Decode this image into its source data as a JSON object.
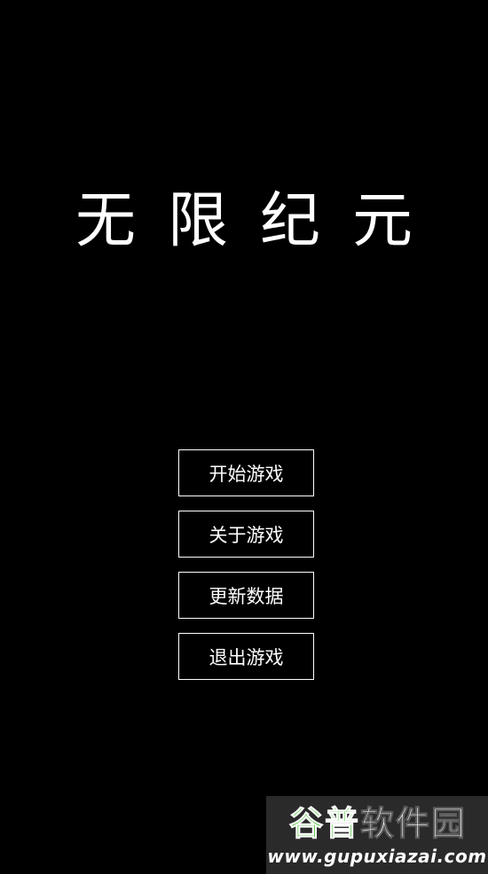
{
  "game": {
    "title": "无限纪元"
  },
  "menu": {
    "items": [
      {
        "label": "开始游戏"
      },
      {
        "label": "关于游戏"
      },
      {
        "label": "更新数据"
      },
      {
        "label": "退出游戏"
      }
    ]
  },
  "watermark": {
    "logo_chars": [
      "谷",
      "普",
      "软",
      "件",
      "园"
    ],
    "url": "www.gupuxiazai.com"
  },
  "colors": {
    "background": "#000000",
    "text": "#ffffff",
    "watermark_green": "#3fbf2a"
  }
}
